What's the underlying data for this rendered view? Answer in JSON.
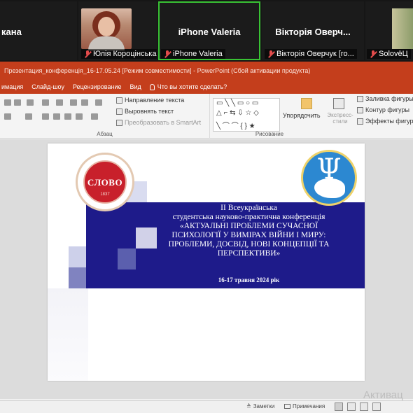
{
  "participants": [
    {
      "display_name": "кана",
      "nameplate": ""
    },
    {
      "display_name": "",
      "nameplate": "Юлія Короцінська"
    },
    {
      "display_name": "iPhone Valeria",
      "nameplate": "iPhone Valeria"
    },
    {
      "display_name": "Вікторія Оверч...",
      "nameplate": "Вікторія Оверчук [го..."
    },
    {
      "display_name": "",
      "nameplate": "SolovёЦ"
    }
  ],
  "active_speaker_color": "#39c234",
  "window": {
    "title": "Презентация_конференція_16-17.05.24 [Режим совместимости] - PowerPoint (Сбой активации продукта)",
    "accent": "#c43e1c"
  },
  "ribbon_tabs": [
    "имация",
    "Слайд-шоу",
    "Рецензирование",
    "Вид"
  ],
  "tell_me": "Что вы хотите сделать?",
  "ribbon": {
    "paragraph": {
      "text_direction": "Направление текста",
      "align_text": "Выровнять текст",
      "smartart": "Преобразовать в SmartArt",
      "label": "Абзац"
    },
    "drawing": {
      "arrange": "Упорядочить",
      "quick_styles": "Экспресс-стили",
      "shape_fill": "Заливка фигуры",
      "shape_outline": "Контур фигуры",
      "shape_effects": "Эффекты фигур",
      "label": "Рисование"
    }
  },
  "slide": {
    "logo_left_word": "СЛОВО",
    "logo_left_year": "1837",
    "logo_right_letter": "Ψ",
    "lines": [
      "ІІ Всеукраїнська",
      "студентська науково-практична конференція",
      "«АКТУАЛЬНІ ПРОБЛЕМИ СУЧАСНОЇ",
      "ПСИХОЛОГІЇ У ВИМІРАХ ВІЙНИ І МИРУ:",
      "ПРОБЛЕМИ, ДОСВІД, НОВІ КОНЦЕПЦІЇ ТА",
      "ПЕРСПЕКТИВИ»"
    ],
    "date": "16-17  травня 2024 рік",
    "band_color": "#1e1b8a"
  },
  "watermark": "Активац",
  "statusbar": {
    "notes": "Заметки",
    "comments": "Примечания"
  }
}
